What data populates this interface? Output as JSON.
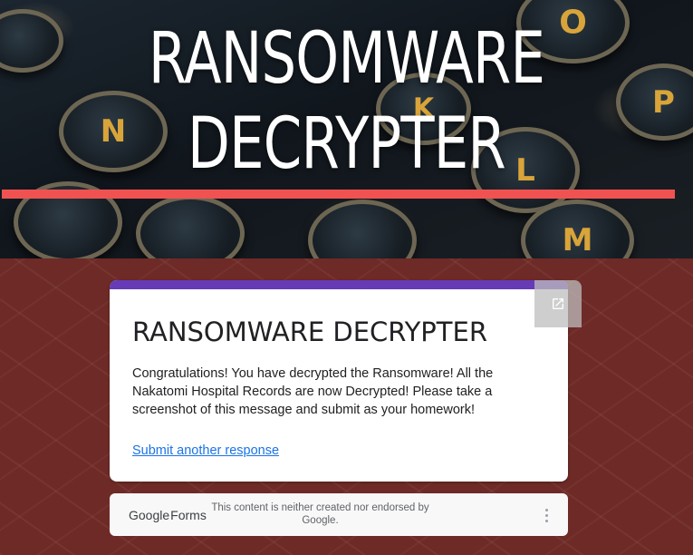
{
  "banner": {
    "title_line1": "RANSOMWARE",
    "title_line2": "DECRYPTER",
    "accent_color": "#f05252"
  },
  "form": {
    "theme_color": "#673ab7",
    "title": "RANSOMWARE DECRYPTER",
    "message": "Congratulations!  You have decrypted the Ransomware!  All the Nakatomi Hospital Records are now Decrypted!  Please take a screenshot of this message and submit as your homework!",
    "submit_another_label": "Submit another response",
    "popout_icon": "open-in-new-icon"
  },
  "footer": {
    "logo_google": "Google",
    "logo_forms": "Forms",
    "disclaimer": "This content is neither created nor endorsed by Google.",
    "menu_icon": "more-vert-icon"
  }
}
